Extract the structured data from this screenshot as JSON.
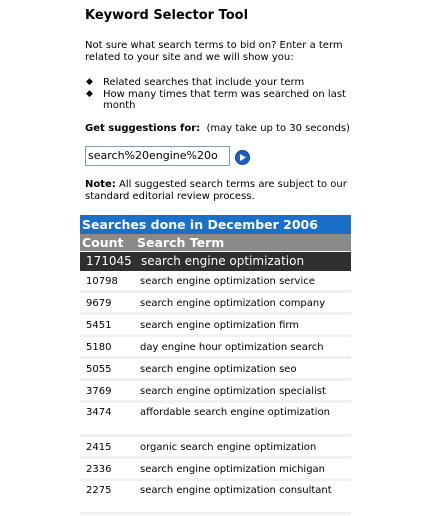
{
  "title": "Keyword Selector Tool",
  "intro": "Not sure what search terms to bid on? Enter a term related to your site and we will show you:",
  "bullets": [
    "Related searches that include your term",
    "How many times that term was searched on last month"
  ],
  "suggest_label": "Get suggestions for:",
  "suggest_hint": "(may take up to 30 seconds)",
  "query_value": "search%20engine%20o",
  "note_label": "Note:",
  "note_text": "All suggested search terms are subject to our standard editorial review process.",
  "results": {
    "heading": "Searches done in December 2006",
    "col_count": "Count",
    "col_term": "Search Term",
    "top": {
      "count": "171045",
      "term": "search engine optimization"
    },
    "rows": [
      {
        "count": "10798",
        "term": "search engine optimization service"
      },
      {
        "count": "9679",
        "term": "search engine optimization company"
      },
      {
        "count": "5451",
        "term": "search engine optimization firm"
      },
      {
        "count": "5180",
        "term": "day engine hour optimization search"
      },
      {
        "count": "5055",
        "term": "search engine optimization seo"
      },
      {
        "count": "3769",
        "term": "search engine optimization specialist"
      },
      {
        "count": "3474",
        "term": "affordable search engine optimization"
      },
      {
        "count": "2415",
        "term": "organic search engine optimization"
      },
      {
        "count": "2336",
        "term": "search engine optimization michigan"
      },
      {
        "count": "2275",
        "term": "search engine optimization consultant"
      }
    ]
  },
  "colors": {
    "heading_bg": "#1a6fc9",
    "columns_bg": "#8a8a8a",
    "top_row_bg": "#2f2f2f",
    "go_button": "#1a5fc2"
  },
  "icons": {
    "go": "arrow-right-circle-icon",
    "bullet": "diamond-bullet-icon"
  }
}
